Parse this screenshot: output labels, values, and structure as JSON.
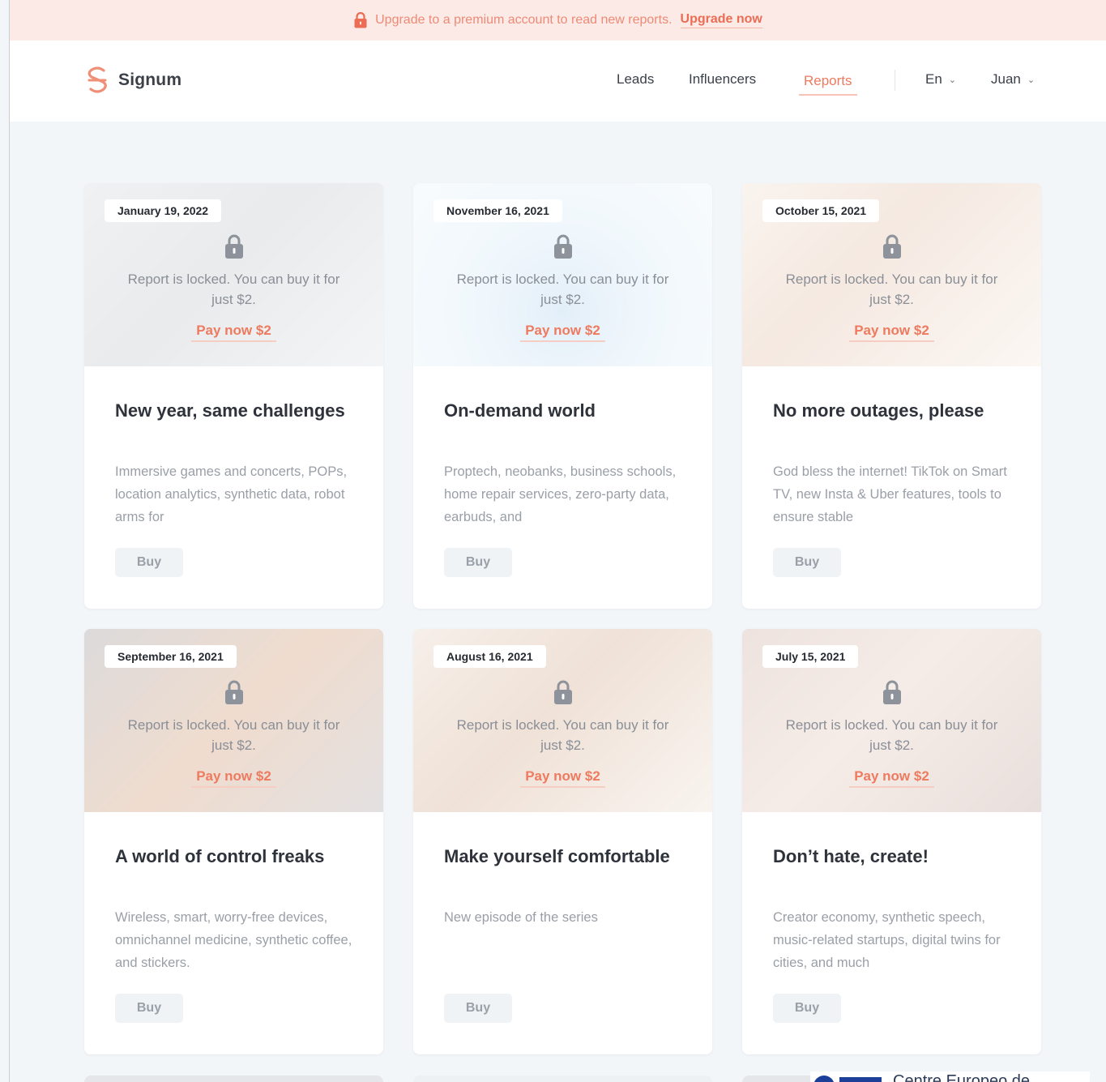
{
  "banner": {
    "text": "Upgrade to a premium account to read new reports.",
    "cta": "Upgrade now"
  },
  "header": {
    "brand": "Signum",
    "nav": [
      "Leads",
      "Influencers",
      "Reports"
    ],
    "active_nav": "Reports",
    "language": "En",
    "user": "Juan"
  },
  "colors": {
    "accent": "#ee7a5f",
    "banner_bg": "#fbeae6",
    "page_bg": "#f3f6f9"
  },
  "locked_text": "Report is locked. You can buy it for just $2.",
  "pay_label": "Pay now $2",
  "buy_label": "Buy",
  "cards": [
    {
      "date": "January 19, 2022",
      "title": "New year, same challenges",
      "desc": "Immersive games and concerts, POPs, location analytics, synthetic data, robot arms for",
      "tone": "gray"
    },
    {
      "date": "November 16, 2021",
      "title": "On-demand world",
      "desc": "Proptech, neobanks, business schools, home repair services, zero-party data, earbuds, and",
      "tone": "sky"
    },
    {
      "date": "October 15, 2021",
      "title": "No more outages, please",
      "desc": "God bless the internet! TikTok on Smart TV, new Insta & Uber features, tools to ensure stable",
      "tone": "warm"
    },
    {
      "date": "September 16, 2021",
      "title": "A world of control freaks",
      "desc": "Wireless, smart, worry-free devices, omnichannel medicine, synthetic coffee, and stickers.",
      "tone": "dusk"
    },
    {
      "date": "August 16, 2021",
      "title": "Make yourself comfortable",
      "desc": "New episode of the series",
      "tone": "cozy"
    },
    {
      "date": "July 15, 2021",
      "title": "Don’t hate, create!",
      "desc": "Creator economy, synthetic speech, music-related startups, digital twins for cities, and much",
      "tone": "rose"
    }
  ],
  "overlay_footer": {
    "text": "Centre Europeo de"
  }
}
